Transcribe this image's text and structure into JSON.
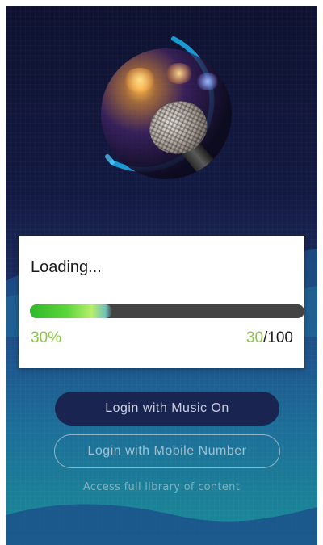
{
  "loading": {
    "title": "Loading...",
    "progress_percent_label": "30%",
    "progress_fraction": 0.3,
    "count_current": "30",
    "count_total": "/100"
  },
  "buttons": {
    "music_on_label": "Login with Music On",
    "mobile_label": "Login with Mobile Number"
  },
  "footer": {
    "access_text": "Access full library of content"
  },
  "colors": {
    "progress_green": "#8bc34a",
    "ring_accent": "#1aa0d8",
    "dark_button": "#1a2450"
  },
  "icons": {
    "hero_image": "microphone-photo"
  }
}
